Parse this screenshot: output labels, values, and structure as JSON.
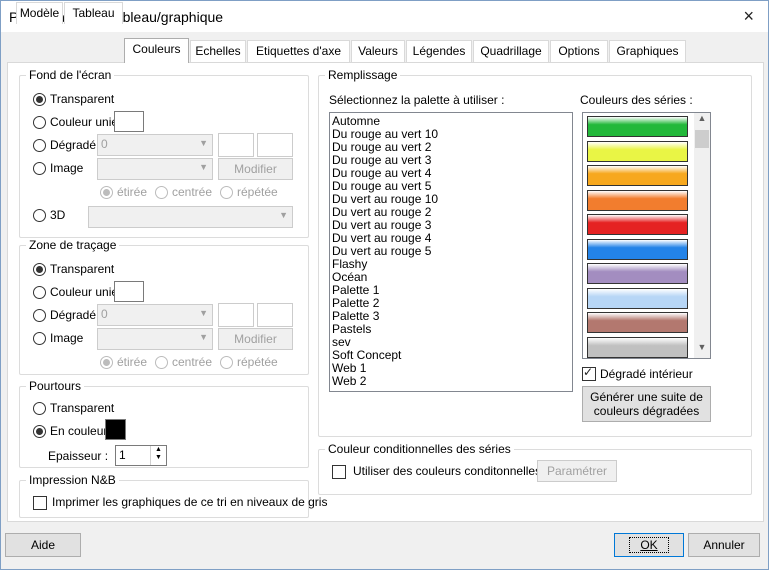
{
  "window": {
    "title": "Présentation du tableau/graphique",
    "close_icon": "×"
  },
  "tabs": [
    {
      "label": "Modèle"
    },
    {
      "label": "Tableau"
    },
    {
      "label": "Couleurs"
    },
    {
      "label": "Echelles"
    },
    {
      "label": "Etiquettes d'axe"
    },
    {
      "label": "Valeurs"
    },
    {
      "label": "Légendes"
    },
    {
      "label": "Quadrillage"
    },
    {
      "label": "Options"
    },
    {
      "label": "Graphiques"
    }
  ],
  "active_tab": "Couleurs",
  "fond": {
    "title": "Fond de l'écran",
    "transparent": "Transparent",
    "couleur_unie": "Couleur unie",
    "degrade": "Dégradé",
    "degrade_value": "0",
    "image": "Image",
    "modifier": "Modifier",
    "etiree": "étirée",
    "centree": "centrée",
    "repetee": "répétée",
    "trois_d": "3D"
  },
  "zone": {
    "title": "Zone de traçage",
    "transparent": "Transparent",
    "couleur_unie": "Couleur unie",
    "degrade": "Dégradé",
    "degrade_value": "0",
    "image": "Image",
    "modifier": "Modifier",
    "etiree": "étirée",
    "centree": "centrée",
    "repetee": "répétée"
  },
  "pourtours": {
    "title": "Pourtours",
    "transparent": "Transparent",
    "en_couleur": "En couleur",
    "color": "#000000",
    "epaisseur_label": "Epaisseur :",
    "epaisseur_value": "1"
  },
  "impression": {
    "title": "Impression N&B",
    "checkbox_label": "Imprimer les graphiques de ce tri en niveaux de gris"
  },
  "remplissage": {
    "title": "Remplissage",
    "palette_label": "Sélectionnez la palette à utiliser :",
    "series_label": "Couleurs des séries :",
    "palettes": [
      "Automne",
      "Du rouge au vert 10",
      "Du rouge au vert 2",
      "Du rouge au vert 3",
      "Du rouge au vert 4",
      "Du rouge au vert 5",
      "Du vert au rouge 10",
      "Du vert au rouge 2",
      "Du vert au rouge 3",
      "Du vert au rouge 4",
      "Du vert au rouge 5",
      "Flashy",
      "Océan",
      "Palette 1",
      "Palette 2",
      "Palette 3",
      "Pastels",
      "sev",
      "Soft Concept",
      "Web 1",
      "Web 2"
    ],
    "series_colors": [
      "#22b83a",
      "#e9f545",
      "#f7a81e",
      "#f27d2e",
      "#e52222",
      "#2383e8",
      "#a38dc0",
      "#b7d6f6",
      "#b3786f",
      "#c0c0c0"
    ],
    "degrade_interieur": "Dégradé intérieur",
    "generate_button": "Générer une suite de couleurs dégradées"
  },
  "conditionnelles": {
    "title": "Couleur conditionnelles des séries",
    "checkbox_label": "Utiliser des couleurs conditonnelles",
    "parametrer": "Paramétrer"
  },
  "footer": {
    "aide": "Aide",
    "ok": "OK",
    "annuler": "Annuler"
  }
}
